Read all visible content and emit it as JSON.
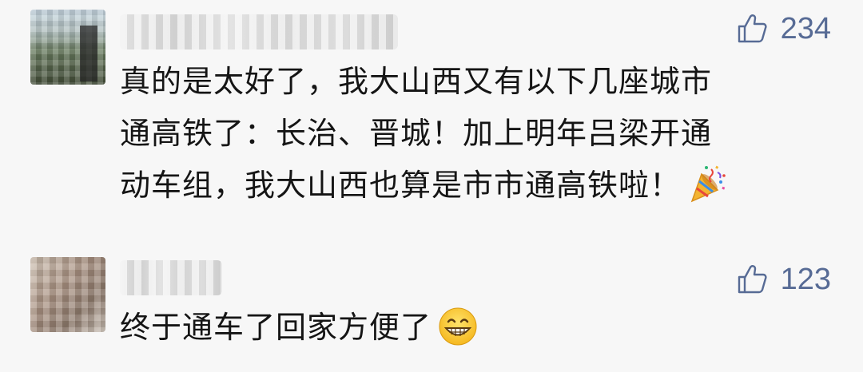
{
  "comments": [
    {
      "likes": "234",
      "text_lines": [
        "真的是太好了，我大山西又有以下几座城市",
        "通高铁了：长治、晋城！加上明年吕梁开通",
        "动车组，我大山西也算是市市通高铁啦！"
      ],
      "emoji": "party-popper-icon"
    },
    {
      "likes": "123",
      "text_lines": [
        "终于通车了回家方便了"
      ],
      "emoji": "grinning-face-icon"
    }
  ],
  "colors": {
    "background": "#f7f7f7",
    "text": "#151515",
    "like_accent": "#576b95"
  }
}
